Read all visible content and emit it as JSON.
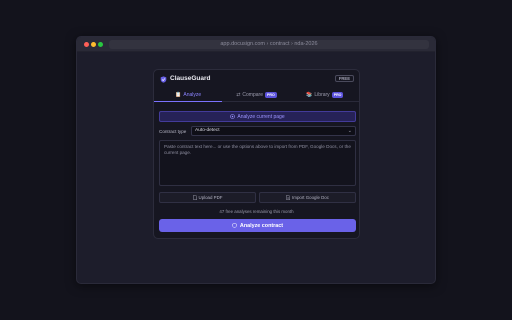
{
  "browser": {
    "url": "app.docusign.com › contract › nda-2026"
  },
  "extension": {
    "brand": "ClauseGuard",
    "plan_badge": "FREE",
    "tabs": [
      {
        "label": "Analyze",
        "icon": "clipboard-icon",
        "active": true
      },
      {
        "label": "Compare",
        "icon": "compare-icon",
        "badge": "PRO"
      },
      {
        "label": "Library",
        "icon": "books-icon",
        "badge": "PRO"
      }
    ],
    "analyze_page_label": "Analyze current page",
    "contract_type_label": "Contract type",
    "contract_type_value": "Auto-detect",
    "textarea_placeholder": "Paste contract text here... or use the options above to import from PDF, Google Docs, or the current page.",
    "upload_pdf_label": "Upload PDF",
    "import_gdoc_label": "Import Google Doc",
    "remaining_text": "47 free analyses remaining this month",
    "analyze_button_label": "Analyze contract",
    "colors": {
      "accent": "#6a62e8",
      "accent_text": "#8b83ff",
      "background": "#13131c"
    }
  }
}
